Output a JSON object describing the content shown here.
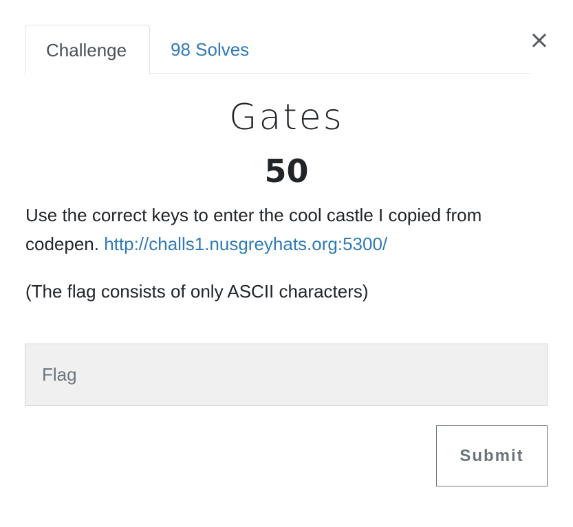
{
  "modal": {
    "close_label": "×"
  },
  "tabs": [
    {
      "label": "Challenge",
      "active": true
    },
    {
      "label": "98 Solves",
      "active": false
    }
  ],
  "challenge": {
    "name": "Gates",
    "points": "50",
    "description_text": "Use the correct keys to enter the cool castle I copied from codepen. ",
    "description_link": "http://challs1.nusgreyhats.org:5300/",
    "note": "(The flag consists of only ASCII characters)"
  },
  "form": {
    "flag_placeholder": "Flag",
    "flag_value": "",
    "submit_label": "Submit"
  },
  "colors": {
    "link": "#2f7bb7",
    "text": "#212529",
    "input_bg": "#f0f0f0",
    "button_border": "#6c757d"
  }
}
